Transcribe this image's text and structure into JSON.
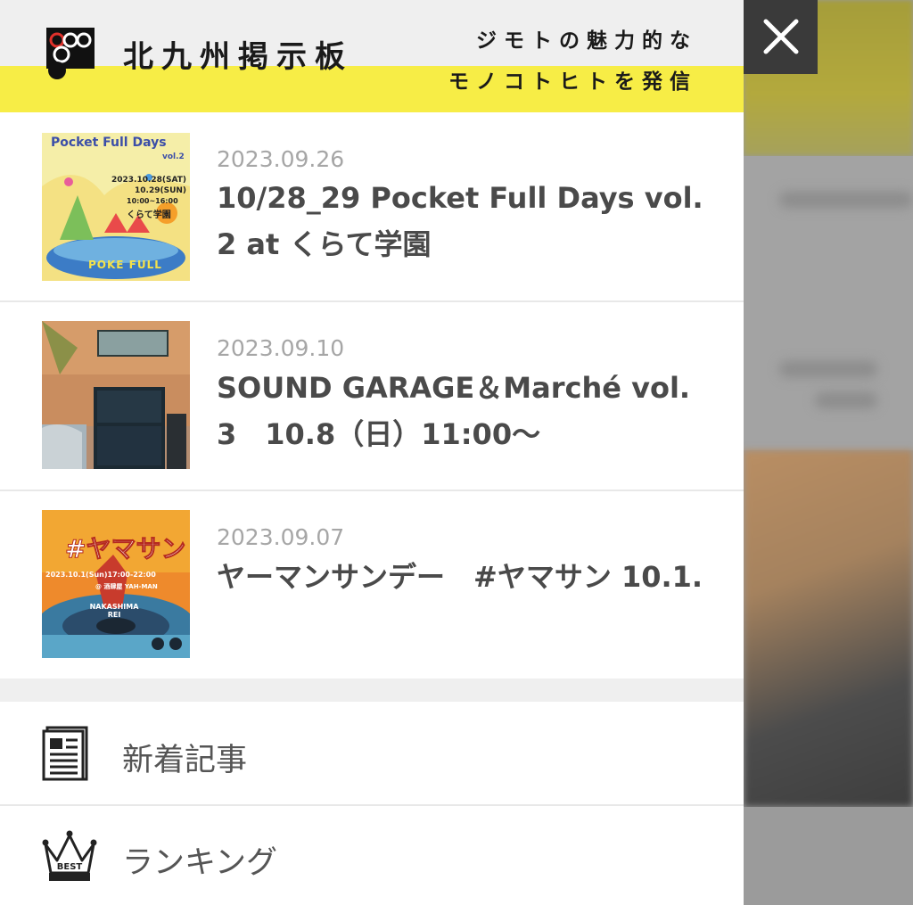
{
  "header": {
    "site_title": "北九州掲示板",
    "tagline_line1": "ジモトの魅力的な",
    "tagline_line2": "モノコトヒトを発信"
  },
  "articles": [
    {
      "date": "2023.09.26",
      "title": "10/28_29 Pocket Full Days vol. 2 at くらて学園",
      "thumb": {
        "heading": "Pocket Full Days",
        "vol": "vol.2",
        "date_line1": "2023.10.28(SAT)",
        "date_line2": "10.29(SUN)",
        "time": "10:00~16:00",
        "venue": "くらて学園",
        "footer": "POKE FULL"
      }
    },
    {
      "date": "2023.09.10",
      "title": "SOUND GARAGE＆Marché vol. 3　10.8（日）11:00〜"
    },
    {
      "date": "2023.09.07",
      "title": "ヤーマンサンデー　#ヤマサン 10.1.",
      "thumb": {
        "heading": "#ヤマサン",
        "date": "2023.10.1(Sun)17:00-22:00",
        "venue": "@ 酒肆屋 YAH-MAN",
        "guest": "NAKASHIMA REI"
      }
    }
  ],
  "menu": [
    {
      "label": "新着記事",
      "icon": "newspaper-icon"
    },
    {
      "label": "ランキング",
      "icon": "crown-icon",
      "icon_text": "BEST"
    }
  ],
  "close_icon": "close-icon",
  "colors": {
    "accent_yellow": "#f7ed46",
    "header_gray": "#efefef",
    "close_bg": "#3a3a3a"
  }
}
